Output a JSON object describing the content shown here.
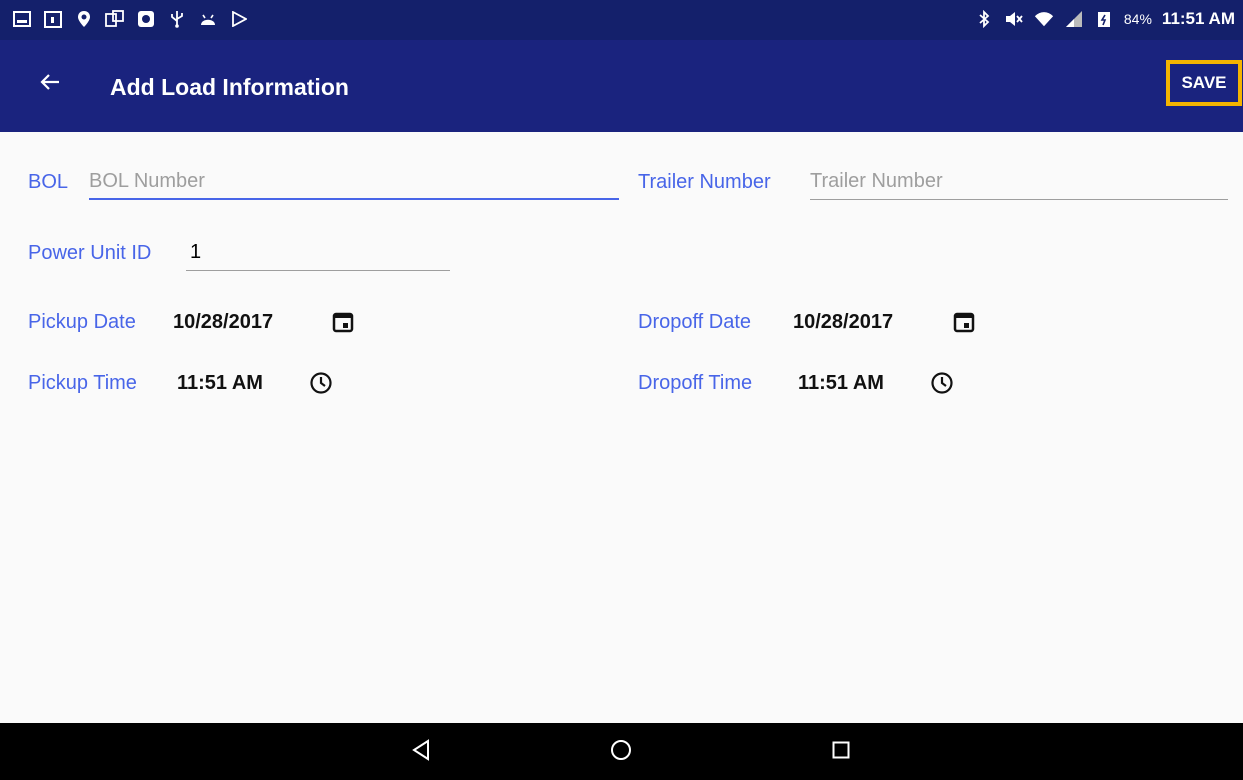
{
  "status_bar": {
    "battery": "84%",
    "time": "11:51 AM"
  },
  "app_bar": {
    "title": "Add Load Information",
    "save_label": "SAVE"
  },
  "form": {
    "bol": {
      "label": "BOL",
      "value": "",
      "placeholder": "BOL Number"
    },
    "trailer": {
      "label": "Trailer Number",
      "value": "",
      "placeholder": "Trailer Number"
    },
    "power_unit": {
      "label": "Power Unit ID",
      "value": "1",
      "placeholder": ""
    },
    "pickup_date": {
      "label": "Pickup Date",
      "value": "10/28/2017"
    },
    "dropoff_date": {
      "label": "Dropoff Date",
      "value": "10/28/2017"
    },
    "pickup_time": {
      "label": "Pickup Time",
      "value": "11:51 AM"
    },
    "dropoff_time": {
      "label": "Dropoff Time",
      "value": "11:51 AM"
    }
  },
  "colors": {
    "status_bar": "#14206b",
    "app_bar": "#1a237e",
    "label": "#4865e8",
    "highlight": "#f4b400"
  },
  "icons": {
    "back": "arrow-back-icon",
    "calendar": "calendar-icon",
    "clock": "clock-icon",
    "nav_back": "triangle-back-icon",
    "nav_home": "circle-home-icon",
    "nav_recents": "square-recents-icon"
  }
}
